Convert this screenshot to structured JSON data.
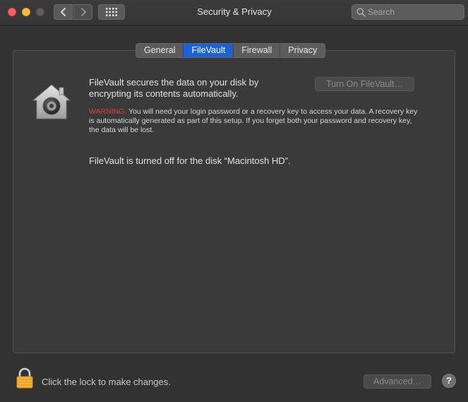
{
  "window": {
    "title": "Security & Privacy"
  },
  "search": {
    "placeholder": "Search",
    "value": ""
  },
  "tabs": [
    {
      "label": "General",
      "active": false
    },
    {
      "label": "FileVault",
      "active": true
    },
    {
      "label": "Firewall",
      "active": false
    },
    {
      "label": "Privacy",
      "active": false
    }
  ],
  "filevault": {
    "description": "FileVault secures the data on your disk by encrypting its contents automatically.",
    "turn_on_button": "Turn On FileVault…",
    "warning_label": "WARNING:",
    "warning_text": " You will need your login password or a recovery key to access your data. A recovery key is automatically generated as part of this setup. If you forget both your password and recovery key, the data will be lost.",
    "status": "FileVault is turned off for the disk “Macintosh HD”."
  },
  "footer": {
    "lock_label": "Click the lock to make changes.",
    "advanced_button": "Advanced…",
    "help_label": "?"
  },
  "icons": {
    "close": "traffic-close-icon",
    "minimize": "traffic-minimize-icon",
    "zoom": "traffic-zoom-icon",
    "back": "chevron-left-icon",
    "forward": "chevron-right-icon",
    "grid": "grid-icon",
    "search": "search-icon",
    "filevault": "filevault-house-icon",
    "lock": "lock-icon",
    "help": "help-icon"
  },
  "colors": {
    "accent": "#1c62d6",
    "warning": "#e63a2e",
    "lock": "#f5b335"
  }
}
